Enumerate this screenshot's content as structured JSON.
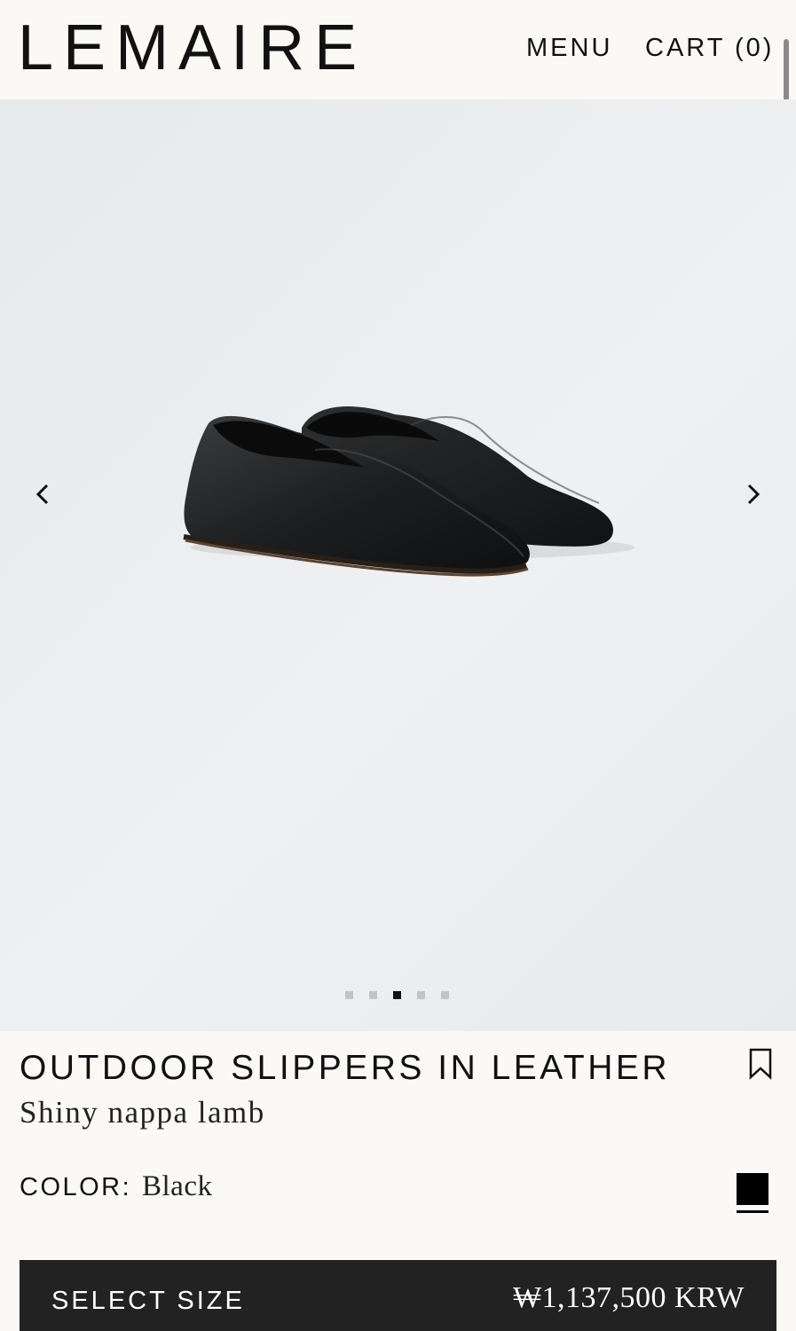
{
  "header": {
    "logo": "LEMAIRE",
    "menu_label": "MENU",
    "cart_label": "CART (0)"
  },
  "gallery": {
    "image_subject": "black leather slippers pair",
    "prev_icon": "chevron-left-icon",
    "next_icon": "chevron-right-icon",
    "slide_count": 5,
    "active_slide": 3,
    "background_color": "#eceef0"
  },
  "product": {
    "title": "OUTDOOR SLIPPERS IN LEATHER",
    "material": "Shiny nappa lamb",
    "bookmark_icon": "bookmark-icon",
    "color_label": "COLOR:",
    "color_value": "Black",
    "swatch_color": "#000000"
  },
  "cta": {
    "label": "SELECT SIZE",
    "price": "₩1,137,500 KRW",
    "background": "#222222"
  }
}
